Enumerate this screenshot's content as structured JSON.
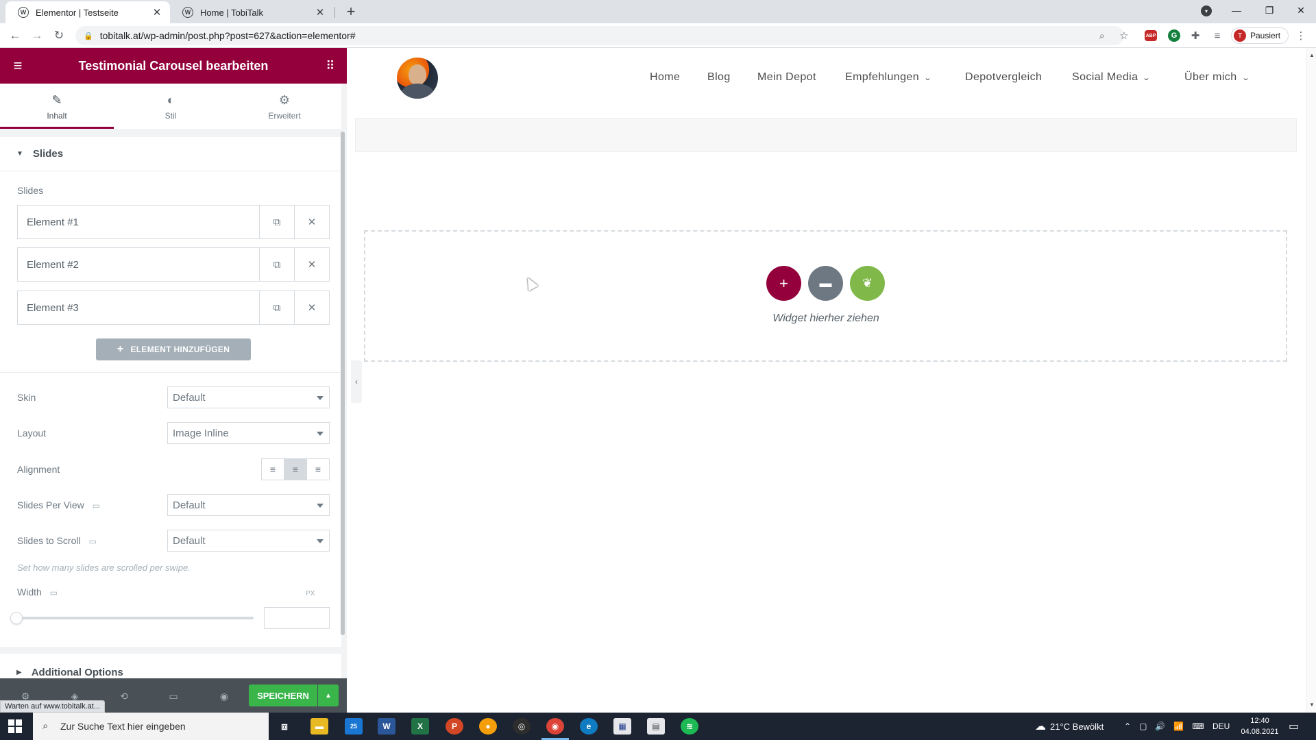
{
  "browser": {
    "tabs": [
      {
        "title": "Elementor | Testseite",
        "active": true
      },
      {
        "title": "Home | TobiTalk",
        "active": false
      }
    ],
    "url": "tobitalk.at/wp-admin/post.php?post=627&action=elementor#",
    "profile_status": "Pausiert",
    "profile_initial": "T",
    "new_tab": "+",
    "close": "✕"
  },
  "panel": {
    "header_title": "Testimonial Carousel bearbeiten",
    "tabs": [
      {
        "label": "Inhalt",
        "icon": "pencil-icon"
      },
      {
        "label": "Stil",
        "icon": "contrast-icon"
      },
      {
        "label": "Erweitert",
        "icon": "gear-icon"
      }
    ],
    "slides_section": {
      "title": "Slides",
      "repeater_label": "Slides",
      "items": [
        "Element #1",
        "Element #2",
        "Element #3"
      ],
      "add_label": "ELEMENT HINZUFÜGEN"
    },
    "controls": {
      "skin": {
        "label": "Skin",
        "value": "Default"
      },
      "layout": {
        "label": "Layout",
        "value": "Image Inline"
      },
      "alignment": {
        "label": "Alignment",
        "selected": "center"
      },
      "slides_per_view": {
        "label": "Slides Per View",
        "value": "Default"
      },
      "slides_to_scroll": {
        "label": "Slides to Scroll",
        "value": "Default"
      },
      "scroll_hint": "Set how many slides are scrolled per swipe.",
      "width": {
        "label": "Width",
        "unit": "PX",
        "value": ""
      }
    },
    "additional_section": {
      "title": "Additional Options"
    },
    "save_label": "SPEICHERN",
    "status_tooltip": "Warten auf www.tobitalk.at..."
  },
  "site": {
    "nav": [
      {
        "label": "Home",
        "dropdown": false
      },
      {
        "label": "Blog",
        "dropdown": false
      },
      {
        "label": "Mein Depot",
        "dropdown": false
      },
      {
        "label": "Empfehlungen",
        "dropdown": true
      },
      {
        "label": "Depotvergleich",
        "dropdown": false
      },
      {
        "label": "Social Media",
        "dropdown": true
      },
      {
        "label": "Über mich",
        "dropdown": true
      }
    ],
    "drop_text": "Widget hierher ziehen"
  },
  "taskbar": {
    "search_placeholder": "Zur Suche Text hier eingeben",
    "weather": "21°C  Bewölkt",
    "language": "DEU",
    "time": "12:40",
    "date": "04.08.2021",
    "mail_badge": "25"
  },
  "colors": {
    "elementor_brand": "#93003c",
    "save_green": "#39b54a",
    "folder_gray": "#6d7882",
    "envato_green": "#80b84a"
  }
}
